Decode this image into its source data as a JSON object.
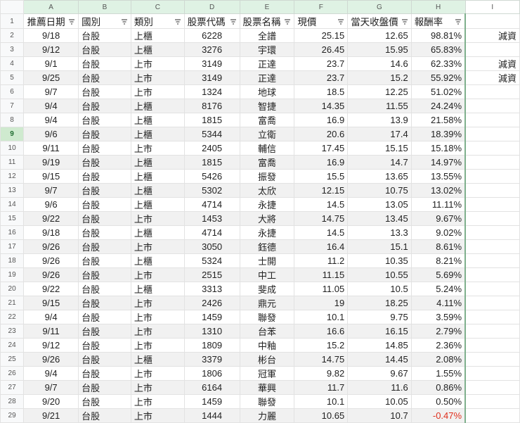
{
  "columns": [
    "A",
    "B",
    "C",
    "D",
    "E",
    "F",
    "G",
    "H",
    "I"
  ],
  "headers": [
    "推薦日期",
    "國別",
    "類別",
    "股票代碼",
    "股票名稱",
    "現價",
    "當天收盤價",
    "報酬率"
  ],
  "selected_row": 9,
  "rows": [
    [
      "9/18",
      "台股",
      "上櫃",
      "6228",
      "全譜",
      "25.15",
      "12.65",
      "98.81%",
      "減資"
    ],
    [
      "9/12",
      "台股",
      "上櫃",
      "3276",
      "宇環",
      "26.45",
      "15.95",
      "65.83%",
      ""
    ],
    [
      "9/1",
      "台股",
      "上市",
      "3149",
      "正達",
      "23.7",
      "14.6",
      "62.33%",
      "減資"
    ],
    [
      "9/25",
      "台股",
      "上市",
      "3149",
      "正達",
      "23.7",
      "15.2",
      "55.92%",
      "減資"
    ],
    [
      "9/7",
      "台股",
      "上市",
      "1324",
      "地球",
      "18.5",
      "12.25",
      "51.02%",
      ""
    ],
    [
      "9/4",
      "台股",
      "上櫃",
      "8176",
      "智捷",
      "14.35",
      "11.55",
      "24.24%",
      ""
    ],
    [
      "9/4",
      "台股",
      "上櫃",
      "1815",
      "富喬",
      "16.9",
      "13.9",
      "21.58%",
      ""
    ],
    [
      "9/6",
      "台股",
      "上櫃",
      "5344",
      "立衛",
      "20.6",
      "17.4",
      "18.39%",
      ""
    ],
    [
      "9/11",
      "台股",
      "上市",
      "2405",
      "輔信",
      "17.45",
      "15.15",
      "15.18%",
      ""
    ],
    [
      "9/19",
      "台股",
      "上櫃",
      "1815",
      "富喬",
      "16.9",
      "14.7",
      "14.97%",
      ""
    ],
    [
      "9/15",
      "台股",
      "上櫃",
      "5426",
      "振發",
      "15.5",
      "13.65",
      "13.55%",
      ""
    ],
    [
      "9/7",
      "台股",
      "上櫃",
      "5302",
      "太欣",
      "12.15",
      "10.75",
      "13.02%",
      ""
    ],
    [
      "9/6",
      "台股",
      "上櫃",
      "4714",
      "永捷",
      "14.5",
      "13.05",
      "11.11%",
      ""
    ],
    [
      "9/22",
      "台股",
      "上市",
      "1453",
      "大將",
      "14.75",
      "13.45",
      "9.67%",
      ""
    ],
    [
      "9/18",
      "台股",
      "上櫃",
      "4714",
      "永捷",
      "14.5",
      "13.3",
      "9.02%",
      ""
    ],
    [
      "9/26",
      "台股",
      "上市",
      "3050",
      "鈺德",
      "16.4",
      "15.1",
      "8.61%",
      ""
    ],
    [
      "9/26",
      "台股",
      "上櫃",
      "5324",
      "士開",
      "11.2",
      "10.35",
      "8.21%",
      ""
    ],
    [
      "9/26",
      "台股",
      "上市",
      "2515",
      "中工",
      "11.15",
      "10.55",
      "5.69%",
      ""
    ],
    [
      "9/22",
      "台股",
      "上櫃",
      "3313",
      "斐成",
      "11.05",
      "10.5",
      "5.24%",
      ""
    ],
    [
      "9/15",
      "台股",
      "上市",
      "2426",
      "鼎元",
      "19",
      "18.25",
      "4.11%",
      ""
    ],
    [
      "9/4",
      "台股",
      "上市",
      "1459",
      "聯發",
      "10.1",
      "9.75",
      "3.59%",
      ""
    ],
    [
      "9/11",
      "台股",
      "上市",
      "1310",
      "台苯",
      "16.6",
      "16.15",
      "2.79%",
      ""
    ],
    [
      "9/12",
      "台股",
      "上市",
      "1809",
      "中釉",
      "15.2",
      "14.85",
      "2.36%",
      ""
    ],
    [
      "9/26",
      "台股",
      "上櫃",
      "3379",
      "彬台",
      "14.75",
      "14.45",
      "2.08%",
      ""
    ],
    [
      "9/4",
      "台股",
      "上市",
      "1806",
      "冠軍",
      "9.82",
      "9.67",
      "1.55%",
      ""
    ],
    [
      "9/7",
      "台股",
      "上市",
      "6164",
      "華興",
      "11.7",
      "11.6",
      "0.86%",
      ""
    ],
    [
      "9/20",
      "台股",
      "上市",
      "1459",
      "聯發",
      "10.1",
      "10.05",
      "0.50%",
      ""
    ],
    [
      "9/21",
      "台股",
      "上市",
      "1444",
      "力麗",
      "10.65",
      "10.7",
      "-0.47%",
      ""
    ]
  ],
  "colors": {
    "negative": "#e0301e",
    "header_bg": "#dff2e4"
  }
}
